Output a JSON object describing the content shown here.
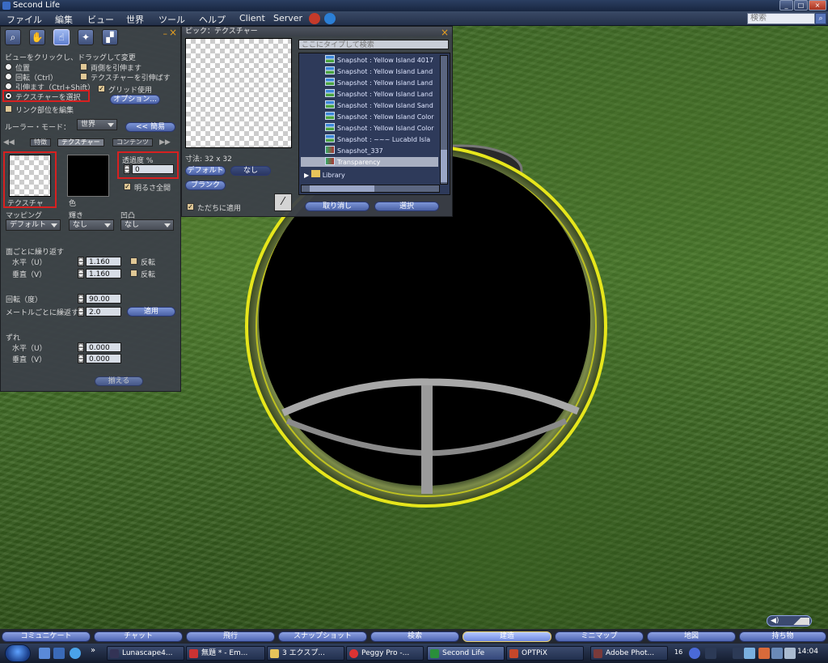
{
  "window": {
    "title": "Second Life"
  },
  "menu": {
    "items": [
      "ファイル",
      "編集",
      "ビュー",
      "世界",
      "ツール",
      "ヘルプ",
      "Client",
      "Server"
    ],
    "search_placeholder": "検索"
  },
  "build_tool": {
    "hint": "ビューをクリックし、ドラッグして変更",
    "radio_position": "位置",
    "radio_rotate": "回転（Ctrl）",
    "radio_stretch": "引伸ます（Ctrl+Shift）",
    "radio_select_texture": "テクスチャーを選択",
    "chk_both_sides": "両側を引伸ます",
    "chk_stretch_textures": "テクスチャーを引伸ばす",
    "chk_use_grid": "グリッド使用",
    "options_button": "オプション...",
    "chk_edit_linked": "リンク部位を編集",
    "ruler_mode_label": "ルーラー・モード：",
    "ruler_mode_value": "世界",
    "simple_button": "<< 簡易",
    "tabs": [
      "特徴",
      "テクスチャー",
      "コンテンツ"
    ],
    "texture_label": "テクスチャ",
    "color_label": "色",
    "transparency_label": "透過度 %",
    "transparency_value": "0",
    "full_bright": "明るさ全開",
    "mapping_label": "マッピング",
    "mapping_value": "デフォルト",
    "shininess_label": "輝き",
    "shininess_value": "なし",
    "bumpiness_label": "凹凸",
    "bumpiness_value": "なし",
    "repeats_per_face": "面ごとに繰り返す",
    "horizontal_u": "水平（U）",
    "vertical_v": "垂直（V）",
    "repeat_u": "1.160",
    "repeat_v": "1.160",
    "flip": "反転",
    "rotation_label": "回転（度）",
    "rotation_value": "90.00",
    "repeats_per_meter": "メートルごとに繰返す",
    "repeats_per_meter_value": "2.0",
    "apply_button": "適用",
    "offset_label": "ずれ",
    "offset_u": "0.000",
    "offset_v": "0.000",
    "align_button": "揃える"
  },
  "texture_picker": {
    "title": "ピック：テクスチャー",
    "search_placeholder": "ここにタイプして検索",
    "size_label": "寸法: 32 x 32",
    "default_button": "デフォルト",
    "none_button": "なし",
    "blank_button": "ブランク",
    "apply_immediately": "ただちに適用",
    "cancel_button": "取り消し",
    "select_button": "選択",
    "items": [
      "Snapshot : Yellow Island 4017",
      "Snapshot : Yellow Island Land",
      "Snapshot : Yellow Island Land",
      "Snapshot : Yellow Island Land",
      "Snapshot : Yellow Island Sand",
      "Snapshot : Yellow Island Color",
      "Snapshot : Yellow Island Color",
      "Snapshot : ~~~ Lucabld Isla",
      "Snapshot_337",
      "Transparency"
    ],
    "library": "Library"
  },
  "bottom_bar": {
    "buttons": [
      "コミュニケート",
      "チャット",
      "飛行",
      "スナップショット",
      "検索",
      "建造",
      "ミニマップ",
      "地図",
      "持ち物"
    ],
    "active": "建造"
  },
  "taskbar": {
    "tasks": [
      "Lunascape4...",
      "無題 * - Em...",
      "3 エクスプ...",
      "Peggy Pro -...",
      "Second Life",
      "OPTPiX",
      "Adobe Phot..."
    ],
    "tray_count": "16",
    "clock": "14:04"
  },
  "colors": {
    "accent": "#5f7fd0",
    "highlight_box": "#d82020",
    "selection_yellow": "#e8e020"
  }
}
